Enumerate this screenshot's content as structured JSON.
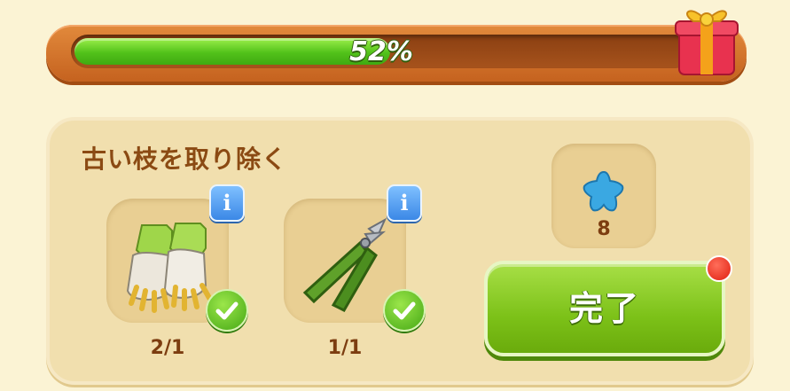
{
  "progress": {
    "percent": 52,
    "label": "52%",
    "reward_icon": "gift-box-icon",
    "colors": {
      "fill": "#52c21a",
      "frame": "#d06c28"
    }
  },
  "task": {
    "title": "古い枝を取り除く",
    "requirements": [
      {
        "icon": "gardening-gloves-icon",
        "count": "2/1",
        "completed": true
      },
      {
        "icon": "pruning-shears-icon",
        "count": "1/1",
        "completed": true
      }
    ],
    "reward": {
      "icon": "blue-star-icon",
      "count": "8"
    },
    "complete_button": {
      "label": "完了",
      "notification": true
    }
  }
}
